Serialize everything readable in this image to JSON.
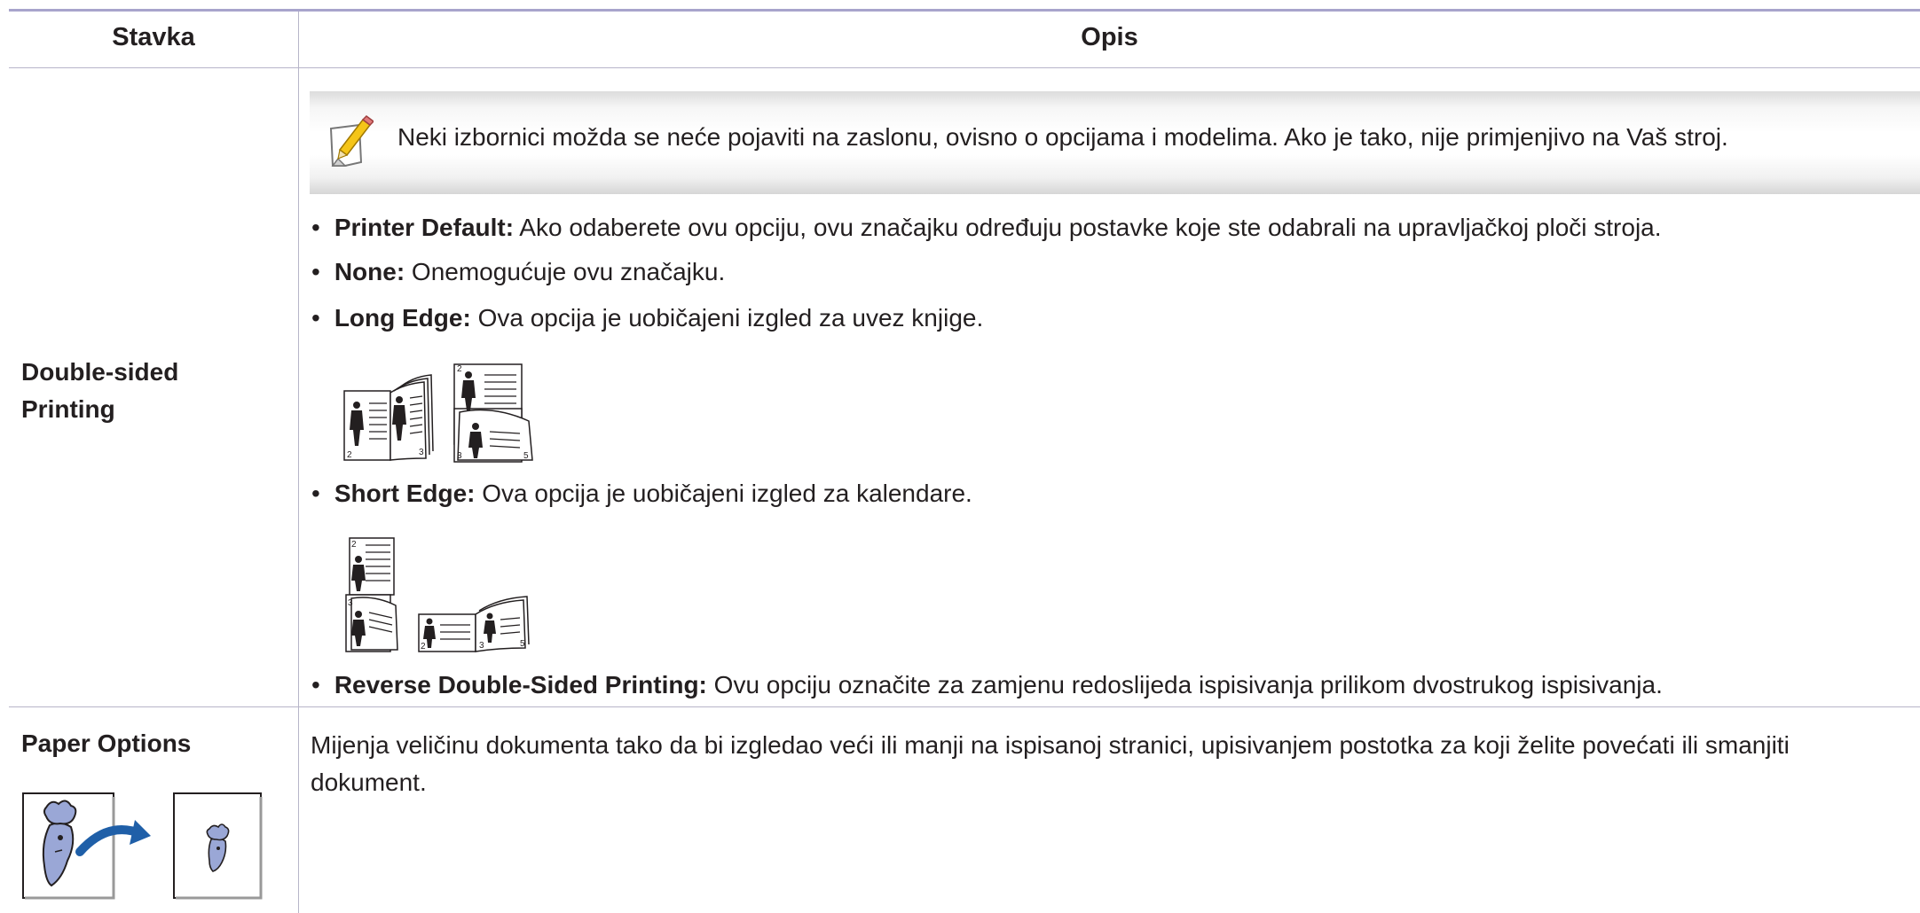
{
  "table": {
    "headers": {
      "item": "Stavka",
      "description": "Opis"
    }
  },
  "row1": {
    "label_line1": "Double-sided",
    "label_line2": "Printing",
    "note": "Neki izbornici možda se neće pojaviti na zaslonu, ovisno o opcijama i modelima. Ako je tako, nije primjenjivo na Vaš stroj.",
    "bullets": [
      {
        "term": "Printer Default:",
        "text": " Ako odaberete ovu opciju, ovu značajku određuju postavke koje ste odabrali na upravljačkoj ploči stroja."
      },
      {
        "term": "None:",
        "text": " Onemogućuje ovu značajku."
      },
      {
        "term": "Long Edge:",
        "text": " Ova opcija je uobičajeni izgled za uvez knjige."
      },
      {
        "term": "Short Edge:",
        "text": " Ova opcija je uobičajeni izgled za kalendare."
      },
      {
        "term": "Reverse Double-Sided Printing:",
        "text": " Ovu opciju označite za zamjenu redoslijeda ispisivanja prilikom dvostrukog ispisivanja."
      }
    ],
    "long_edge_page_numbers": [
      "2",
      "3",
      "2",
      "3",
      "5"
    ],
    "short_edge_page_numbers": [
      "2",
      "3",
      "2",
      "3",
      "5"
    ]
  },
  "row2": {
    "label": "Paper Options",
    "description": "Mijenja veličinu dokumenta tako da bi izgledao veći ili manji na ispisanoj stranici, upisivanjem postotka za koji želite povećati ili smanjiti dokument."
  },
  "icons": {
    "note": "note-pencil-icon",
    "scale": "scale-document-icon"
  },
  "colors": {
    "top_rule": "#a8a4cc",
    "grid_line": "#b7b5c9",
    "text": "#231f20",
    "illustration_blue": "#9aa7d6",
    "arrow_blue": "#1f5fa8"
  }
}
